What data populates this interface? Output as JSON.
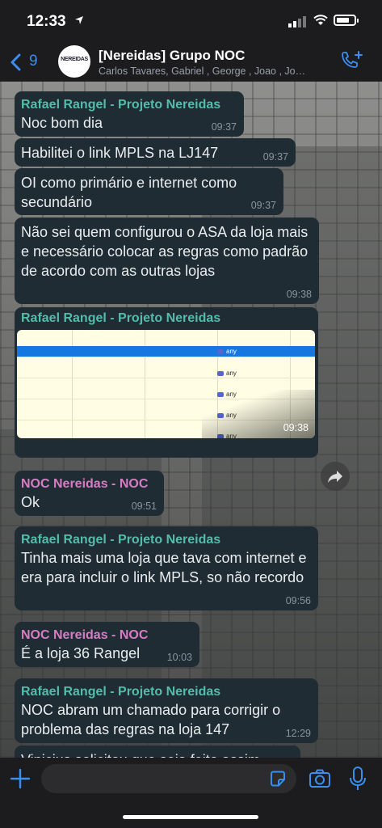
{
  "status": {
    "time": "12:33"
  },
  "header": {
    "back_count": "9",
    "avatar_text": "NEREIDAS",
    "title": "[Nereidas] Grupo NOC",
    "subtitle": "Carlos Tavares, Gabriel , George , Joao , Jo…"
  },
  "messages": [
    {
      "sender": "Rafael Rangel - Projeto Nereidas",
      "text": "Noc bom dia",
      "time": "09:37"
    },
    {
      "text": "Habilitei o link MPLS na LJ147",
      "time": "09:37"
    },
    {
      "text": "OI como primário e internet como secundário",
      "time": "09:37"
    },
    {
      "text": "Não sei quem configurou o ASA da loja mais e necessário colocar as regras como padrão de acordo com as outras lojas",
      "time": "09:38"
    },
    {
      "sender": "Rafael Rangel - Projeto Nereidas",
      "image_labels": [
        "any",
        "any",
        "any",
        "any",
        "any"
      ],
      "time": "09:38"
    },
    {
      "sender": "NOC Nereidas - NOC",
      "text": "Ok",
      "time": "09:51"
    },
    {
      "sender": "Rafael Rangel - Projeto Nereidas",
      "text": "Tinha mais uma loja que tava com internet e era para incluir o link MPLS, so não recordo",
      "time": "09:56"
    },
    {
      "sender": "NOC Nereidas - NOC",
      "text": "É a loja 36 Rangel",
      "time": "10:03"
    },
    {
      "sender": "Rafael Rangel - Projeto Nereidas",
      "text": "NOC abram um chamado para corrigir o problema das regras na loja 147",
      "time": "12:29"
    },
    {
      "text": "Vinicius solicitou que seja feito assim"
    }
  ],
  "colors": {
    "accent": "#3b8ef0",
    "sender_rafael": "#53bdac",
    "sender_noc": "#d67ec3",
    "bubble": "#202c33"
  }
}
